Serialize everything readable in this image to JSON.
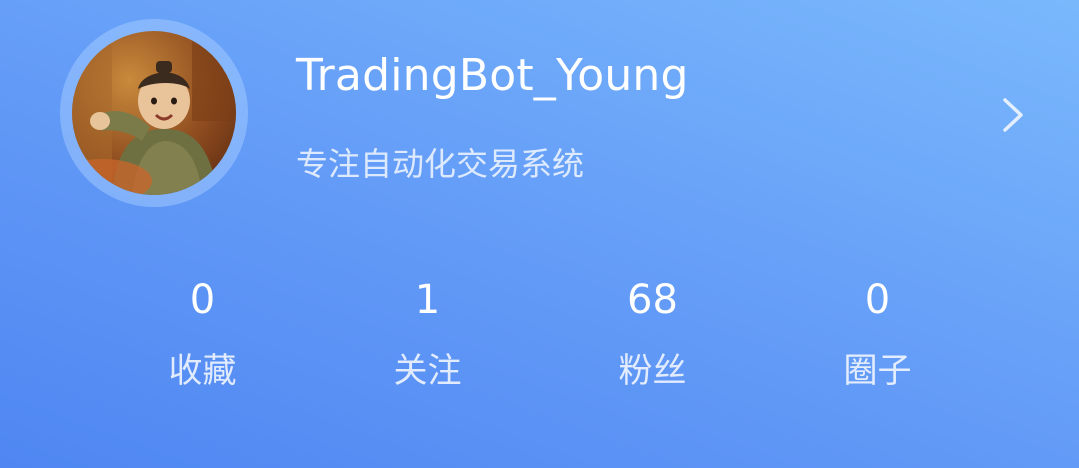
{
  "profile": {
    "username": "TradingBot_Young",
    "bio": "专注自动化交易系统",
    "avatar_icon": "user-avatar-photo",
    "chevron_icon": "chevron-right-icon"
  },
  "stats": [
    {
      "value": "0",
      "label": "收藏"
    },
    {
      "value": "1",
      "label": "关注"
    },
    {
      "value": "68",
      "label": "粉丝"
    },
    {
      "value": "0",
      "label": "圈子"
    }
  ],
  "colors": {
    "background_start": "#4f86f2",
    "background_end": "#7ab8fc",
    "text_primary": "#ffffff"
  }
}
